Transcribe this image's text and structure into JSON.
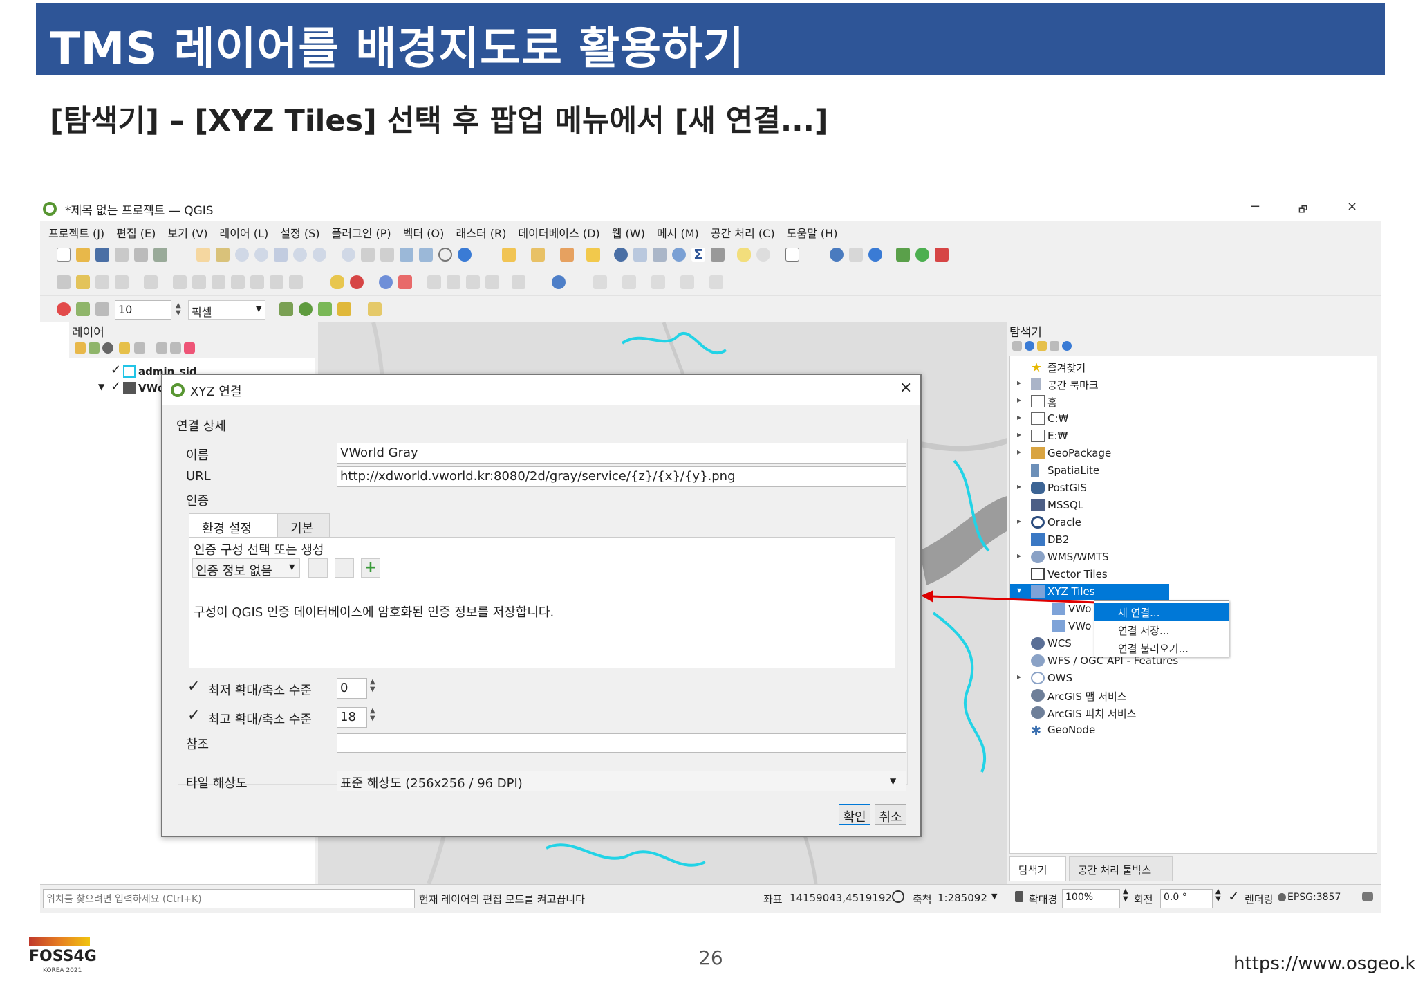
{
  "slide": {
    "title": "TMS 레이어를 배경지도로 활용하기",
    "subtitle": "[탐색기] – [XYZ Tiles] 선택 후 팝업 메뉴에서 [새 연결...]",
    "page_number": "26",
    "url": "https://www.osgeo.kr",
    "logo_text": "FOSS4G",
    "logo_subtext": "KOREA 2021"
  },
  "window": {
    "title": "*제목 없는 프로젝트 — QGIS",
    "minimize": "−",
    "restore": "🗗",
    "close": "×"
  },
  "menubar": [
    "프로젝트 (J)",
    "편집 (E)",
    "보기 (V)",
    "레이어 (L)",
    "설정 (S)",
    "플러그인 (P)",
    "벡터 (O)",
    "래스터 (R)",
    "데이터베이스 (D)",
    "웹 (W)",
    "메시 (M)",
    "공간 처리 (C)",
    "도움말 (H)"
  ],
  "snapping": {
    "tolerance": "10",
    "unit": "픽셀"
  },
  "layers_panel": {
    "title": "레이어",
    "layers": [
      "admin_sid",
      "VWorld"
    ]
  },
  "browser_panel": {
    "title": "탐색기",
    "items": [
      {
        "label": "즐겨찾기",
        "expand": ""
      },
      {
        "label": "공간 북마크",
        "expand": "▸"
      },
      {
        "label": "홈",
        "expand": "▸"
      },
      {
        "label": "C:₩",
        "expand": "▸"
      },
      {
        "label": "E:₩",
        "expand": "▸"
      },
      {
        "label": "GeoPackage",
        "expand": "▸"
      },
      {
        "label": "SpatiaLite",
        "expand": ""
      },
      {
        "label": "PostGIS",
        "expand": "▸"
      },
      {
        "label": "MSSQL",
        "expand": ""
      },
      {
        "label": "Oracle",
        "expand": "▸"
      },
      {
        "label": "DB2",
        "expand": ""
      },
      {
        "label": "WMS/WMTS",
        "expand": "▸"
      },
      {
        "label": "Vector Tiles",
        "expand": ""
      },
      {
        "label": "XYZ Tiles",
        "expand": "▾"
      },
      {
        "label": "VWo",
        "expand": ""
      },
      {
        "label": "VWo",
        "expand": ""
      },
      {
        "label": "WCS",
        "expand": ""
      },
      {
        "label": "WFS / OGC API - Features",
        "expand": ""
      },
      {
        "label": "OWS",
        "expand": "▸"
      },
      {
        "label": "ArcGIS 맵 서비스",
        "expand": ""
      },
      {
        "label": "ArcGIS 피처 서비스",
        "expand": ""
      },
      {
        "label": "GeoNode",
        "expand": ""
      }
    ],
    "bottom_tabs": [
      "탐색기",
      "공간 처리 툴박스"
    ]
  },
  "context_menu": {
    "items": [
      "새 연결...",
      "연결 저장...",
      "연결 불러오기..."
    ]
  },
  "dialog": {
    "title": "XYZ 연결",
    "close": "×",
    "section": "연결 상세",
    "name_label": "이름",
    "name_value": "VWorld Gray",
    "url_label": "URL",
    "url_value": "http://xdworld.vworld.kr:8080/2d/gray/service/{z}/{x}/{y}.png",
    "auth_label": "인증",
    "auth_tabs": [
      "환경 설정",
      "기본"
    ],
    "auth_hint": "인증 구성 선택 또는 생성",
    "auth_select": "인증 정보 없음",
    "auth_note": "구성이 QGIS 인증 데이터베이스에 암호화된 인증 정보를 저장합니다.",
    "min_zoom_label": "최저 확대/축소 수준",
    "min_zoom_value": "0",
    "max_zoom_label": "최고 확대/축소 수준",
    "max_zoom_value": "18",
    "referer_label": "참조",
    "referer_value": "",
    "tile_res_label": "타일 해상도",
    "tile_res_value": "표준 해상도 (256x256 / 96 DPI)",
    "ok": "확인",
    "cancel": "취소"
  },
  "statusbar": {
    "locator_placeholder": "위치를 찾으려면 입력하세요 (Ctrl+K)",
    "message": "현재 레이어의 편집 모드를 켜고끕니다",
    "coord_label": "좌표",
    "coord_value": "14159043,4519192",
    "scale_label": "축척",
    "scale_value": "1:285092",
    "magnifier_label": "확대경",
    "magnifier_value": "100%",
    "rotation_label": "회전",
    "rotation_value": "0.0 °",
    "render_label": "렌더링",
    "crs": "EPSG:3857"
  },
  "colors": {
    "title_bar": "#2e5597",
    "qgis_green": "#589632",
    "selection": "#0078d7",
    "annotation_arrow": "#e00000",
    "boundary": "#22d3e6"
  }
}
